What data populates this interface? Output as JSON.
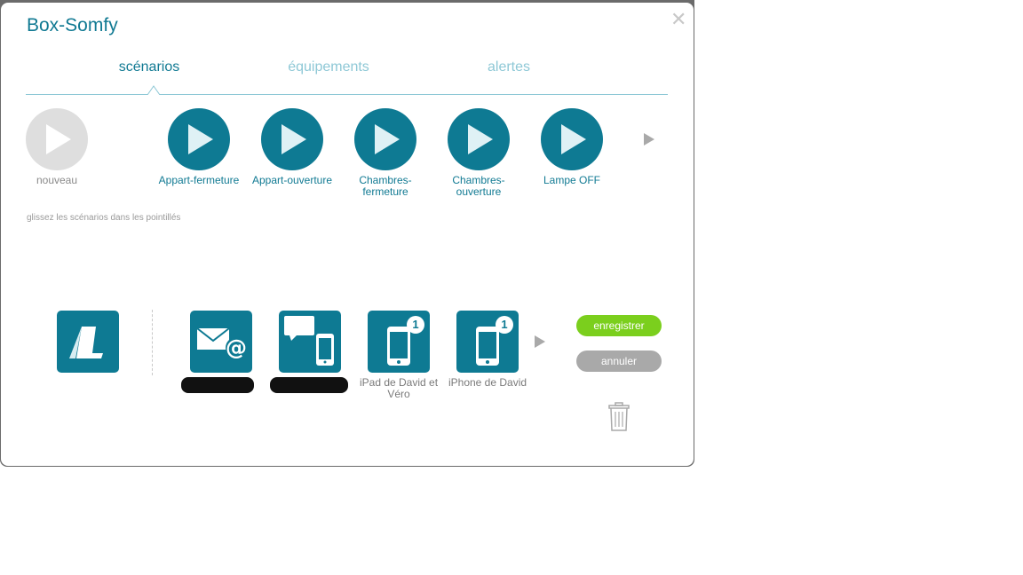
{
  "dialog": {
    "title": "Box-Somfy",
    "close_glyph": "✕"
  },
  "tabs": [
    {
      "label": "scénarios",
      "active": true
    },
    {
      "label": "équipements",
      "active": false
    },
    {
      "label": "alertes",
      "active": false
    }
  ],
  "scenarios": {
    "new_label": "nouveau",
    "items": [
      {
        "label": "Appart-fermeture"
      },
      {
        "label": "Appart-ouverture"
      },
      {
        "label": "Chambres-fermeture"
      },
      {
        "label": "Chambres-ouverture"
      },
      {
        "label": "Lampe OFF"
      }
    ],
    "hint": "glissez les scénarios dans les pointillés"
  },
  "alerts": {
    "devices": [
      {
        "icon": "email-icon",
        "label": ""
      },
      {
        "icon": "sms-phone-icon",
        "label": ""
      },
      {
        "icon": "mobile-app-icon",
        "label": "iPad de David et Véro",
        "badge": "1"
      },
      {
        "icon": "mobile-app-icon",
        "label": "iPhone de David",
        "badge": "1"
      }
    ]
  },
  "actions": {
    "save_label": "enregistrer",
    "cancel_label": "annuler"
  },
  "colors": {
    "accent": "#0e7a93",
    "tab_inactive": "#8ec8d6",
    "save": "#7bcf1d",
    "cancel": "#a9a9a9"
  }
}
